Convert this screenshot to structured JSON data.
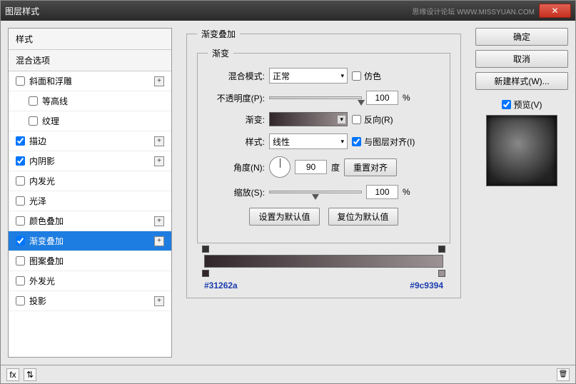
{
  "title": "图层样式",
  "watermark": "思缘设计论坛 WWW.MISSYUAN.COM",
  "left": {
    "header_styles": "样式",
    "header_blend": "混合选项",
    "items": [
      {
        "label": "斜面和浮雕",
        "checked": false,
        "has_add": true,
        "indent": false
      },
      {
        "label": "等高线",
        "checked": false,
        "has_add": false,
        "indent": true
      },
      {
        "label": "纹理",
        "checked": false,
        "has_add": false,
        "indent": true
      },
      {
        "label": "描边",
        "checked": true,
        "has_add": true,
        "indent": false
      },
      {
        "label": "内阴影",
        "checked": true,
        "has_add": true,
        "indent": false
      },
      {
        "label": "内发光",
        "checked": false,
        "has_add": false,
        "indent": false
      },
      {
        "label": "光泽",
        "checked": false,
        "has_add": false,
        "indent": false
      },
      {
        "label": "颜色叠加",
        "checked": false,
        "has_add": true,
        "indent": false
      },
      {
        "label": "渐变叠加",
        "checked": true,
        "has_add": true,
        "indent": false,
        "active": true
      },
      {
        "label": "图案叠加",
        "checked": false,
        "has_add": false,
        "indent": false
      },
      {
        "label": "外发光",
        "checked": false,
        "has_add": false,
        "indent": false
      },
      {
        "label": "投影",
        "checked": false,
        "has_add": true,
        "indent": false
      }
    ]
  },
  "center": {
    "group_title": "渐变叠加",
    "inner_title": "渐变",
    "blend_mode_label": "混合模式:",
    "blend_mode_value": "正常",
    "dither_label": "仿色",
    "opacity_label": "不透明度(P):",
    "opacity_value": "100",
    "opacity_unit": "%",
    "gradient_label": "渐变:",
    "reverse_label": "反向(R)",
    "style_label": "样式:",
    "style_value": "线性",
    "align_label": "与图层对齐(I)",
    "angle_label": "角度(N):",
    "angle_value": "90",
    "angle_unit": "度",
    "reset_align": "重置对齐",
    "scale_label": "缩放(S):",
    "scale_value": "100",
    "scale_unit": "%",
    "set_default": "设置为默认值",
    "reset_default": "复位为默认值",
    "color_left": "#31262a",
    "color_right": "#9c9394"
  },
  "right": {
    "ok": "确定",
    "cancel": "取消",
    "new_style": "新建样式(W)...",
    "preview_label": "预览(V)"
  },
  "bottom": {
    "fx": "fx",
    "arrows": "⇅"
  }
}
